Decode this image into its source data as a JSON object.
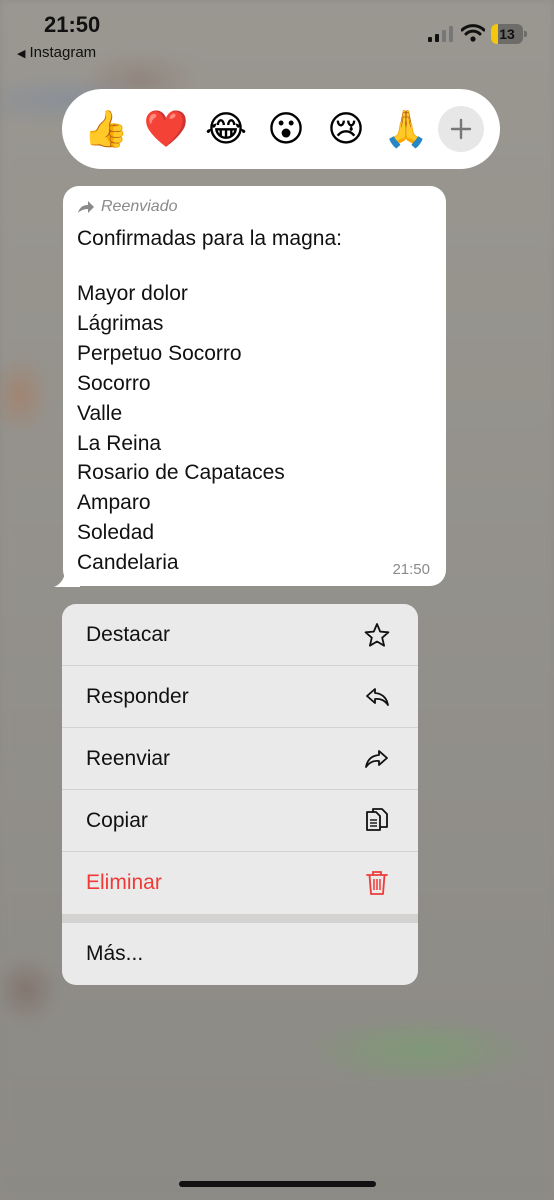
{
  "status_bar": {
    "time": "21:50",
    "back_app": "Instagram",
    "battery_level": "13",
    "battery_color": "#f4c70d"
  },
  "reactions": [
    {
      "emoji": "👍",
      "name": "thumbs-up"
    },
    {
      "emoji": "❤️",
      "name": "heart"
    },
    {
      "emoji": "😂",
      "name": "laughing"
    },
    {
      "emoji": "😮",
      "name": "surprised"
    },
    {
      "emoji": "😢",
      "name": "crying"
    },
    {
      "emoji": "🙏",
      "name": "praying-hands"
    }
  ],
  "message": {
    "forwarded_label": "Reenviado",
    "title": "Confirmadas para la magna:",
    "items": [
      "Mayor dolor",
      "Lágrimas",
      "Perpetuo Socorro",
      "Socorro",
      "Valle",
      "La Reina",
      "Rosario de Capataces",
      "Amparo",
      "Soledad",
      "Candelaria"
    ],
    "time": "21:50"
  },
  "menu": {
    "items": [
      {
        "label": "Destacar",
        "icon": "star-icon"
      },
      {
        "label": "Responder",
        "icon": "reply-icon"
      },
      {
        "label": "Reenviar",
        "icon": "forward-icon"
      },
      {
        "label": "Copiar",
        "icon": "copy-icon"
      },
      {
        "label": "Eliminar",
        "icon": "trash-icon",
        "color": "#ee3b37"
      }
    ],
    "more_label": "Más..."
  }
}
